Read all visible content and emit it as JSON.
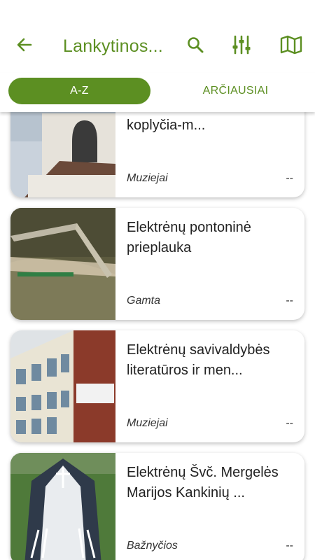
{
  "header": {
    "title": "Lankytinos...",
    "back_icon": "arrow-left-icon",
    "search_icon": "search-icon",
    "filter_icon": "sliders-icon",
    "map_icon": "map-icon",
    "accent": "#5c8f22"
  },
  "tabs": [
    {
      "label": "A-Z",
      "active": true
    },
    {
      "label": "ARČIAUSIAI",
      "active": false
    }
  ],
  "items": [
    {
      "name": "Broel-Pliaterių šeimų koplyčia-m...",
      "category": "Muziejai",
      "distance": "--"
    },
    {
      "name": "Elektrėnų pontoninė prieplauka",
      "category": "Gamta",
      "distance": "--"
    },
    {
      "name": "Elektrėnų savivaldybės literatūros ir men...",
      "category": "Muziejai",
      "distance": "--"
    },
    {
      "name": "Elektrėnų Švč. Mergelės Marijos Kankinių ...",
      "category": "Bažnyčios",
      "distance": "--"
    }
  ]
}
